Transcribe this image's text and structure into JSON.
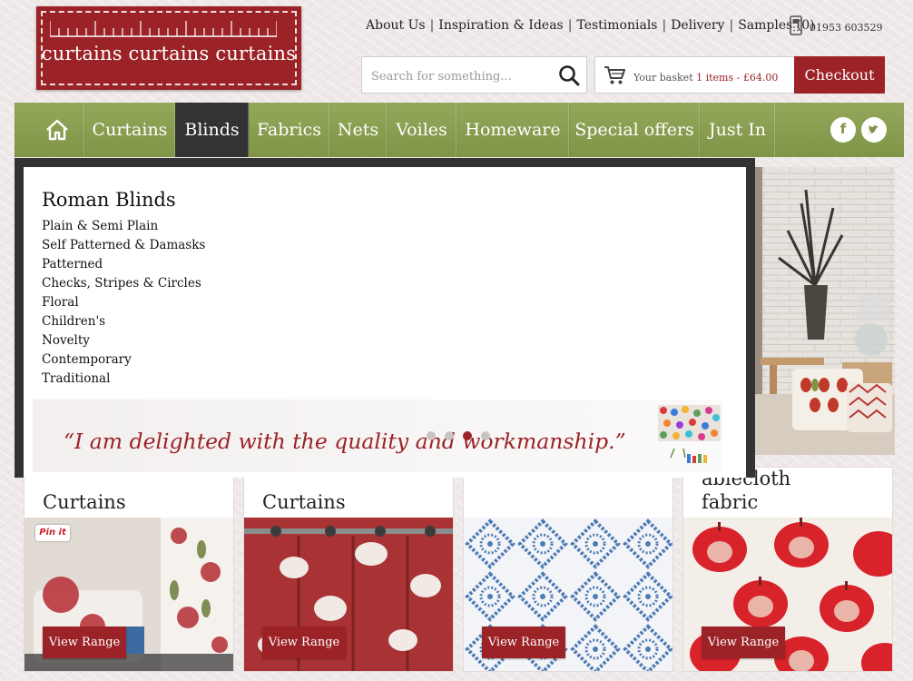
{
  "logo": {
    "text": "curtains curtains curtains"
  },
  "top_links": [
    "About Us",
    "Inspiration & Ideas",
    "Testimonials",
    "Delivery",
    "Samples (0)"
  ],
  "phone": "01953 603529",
  "search": {
    "placeholder": "Search for something..."
  },
  "basket": {
    "label": "Your basket",
    "summary": "1 items - £64.00",
    "checkout_label": "Checkout"
  },
  "nav": {
    "items": [
      "Curtains",
      "Blinds",
      "Fabrics",
      "Nets",
      "Voiles",
      "Homeware",
      "Special offers",
      "Just In"
    ],
    "active": "Blinds"
  },
  "dropdown": {
    "title": "Roman Blinds",
    "items": [
      "Plain & Semi Plain",
      "Self Patterned & Damasks",
      "Patterned",
      "Checks, Stripes & Circles",
      "Floral",
      "Children's",
      "Novelty",
      "Contemporary",
      "Traditional"
    ]
  },
  "testimonial": {
    "quote": "“I am delighted with the quality and workmanship.”"
  },
  "slider": {
    "dot_count": 4,
    "active_dot": 3
  },
  "products": [
    {
      "title": "Curtains",
      "button": "View Range",
      "pin_label": "Pin it"
    },
    {
      "title": "Curtains",
      "button": "View Range"
    },
    {
      "title": "",
      "button": "View Range"
    },
    {
      "title": "fabric",
      "title_partial": "ablecloth",
      "button": "View Range"
    }
  ],
  "colors": {
    "brand_red": "#9b2226",
    "nav_green": "#8a9f50",
    "dropdown_dark": "#333333"
  }
}
